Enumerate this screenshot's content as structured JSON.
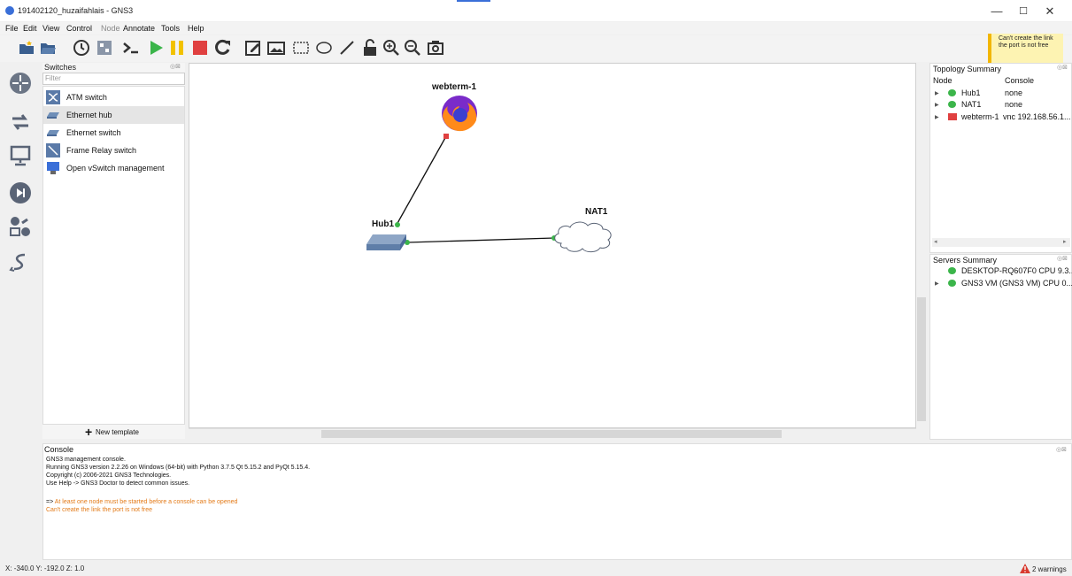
{
  "window": {
    "title": "191402120_huzaifahlais - GNS3",
    "minimize": "—",
    "maximize": "☐",
    "close": "✕"
  },
  "menu": [
    "File",
    "Edit",
    "View",
    "Control",
    "Node",
    "Annotate",
    "Tools",
    "Help"
  ],
  "toast": "Can't create the link the port is not free",
  "switches_dock": {
    "title": "Switches",
    "filter_placeholder": "Filter",
    "items": [
      "ATM switch",
      "Ethernet hub",
      "Ethernet switch",
      "Frame Relay switch",
      "Open vSwitch management"
    ],
    "selected_item": "Ethernet hub",
    "new_template": "New template",
    "plus": "+"
  },
  "canvas": {
    "nodes": [
      {
        "label": "webterm-1"
      },
      {
        "label": "Hub1"
      },
      {
        "label": "NAT1"
      }
    ]
  },
  "topology_summary": {
    "title": "Topology Summary",
    "col_node": "Node",
    "col_console": "Console",
    "rows": [
      {
        "node": "Hub1",
        "console": "none",
        "status": "green"
      },
      {
        "node": "NAT1",
        "console": "none",
        "status": "green"
      },
      {
        "node": "webterm-1",
        "console": "vnc 192.168.56.1...",
        "status": "red"
      }
    ]
  },
  "servers_summary": {
    "title": "Servers Summary",
    "rows": [
      "DESKTOP-RQ607F0 CPU 9.3...",
      "GNS3 VM (GNS3 VM) CPU 0..."
    ]
  },
  "console": {
    "title": "Console",
    "lines": [
      "GNS3 management console.",
      "Running GNS3 version 2.2.26 on Windows (64-bit) with Python 3.7.5 Qt 5.15.2 and PyQt 5.15.4.",
      "Copyright (c) 2006-2021 GNS3 Technologies.",
      "Use Help -> GNS3 Doctor to detect common issues."
    ],
    "prompt": "=>",
    "warn_lines": [
      "At least one node must be started before a console can be opened",
      "Can't create the link the port is not free"
    ]
  },
  "status": {
    "coords": "X: -340.0 Y: -192.0 Z: 1.0",
    "warnings": "2 warnings"
  },
  "colors": {
    "green": "#3bb54a",
    "red": "#e04040",
    "warn": "#e37a18",
    "toast_bg": "#fdf3b2",
    "toast_accent": "#f2b600"
  }
}
